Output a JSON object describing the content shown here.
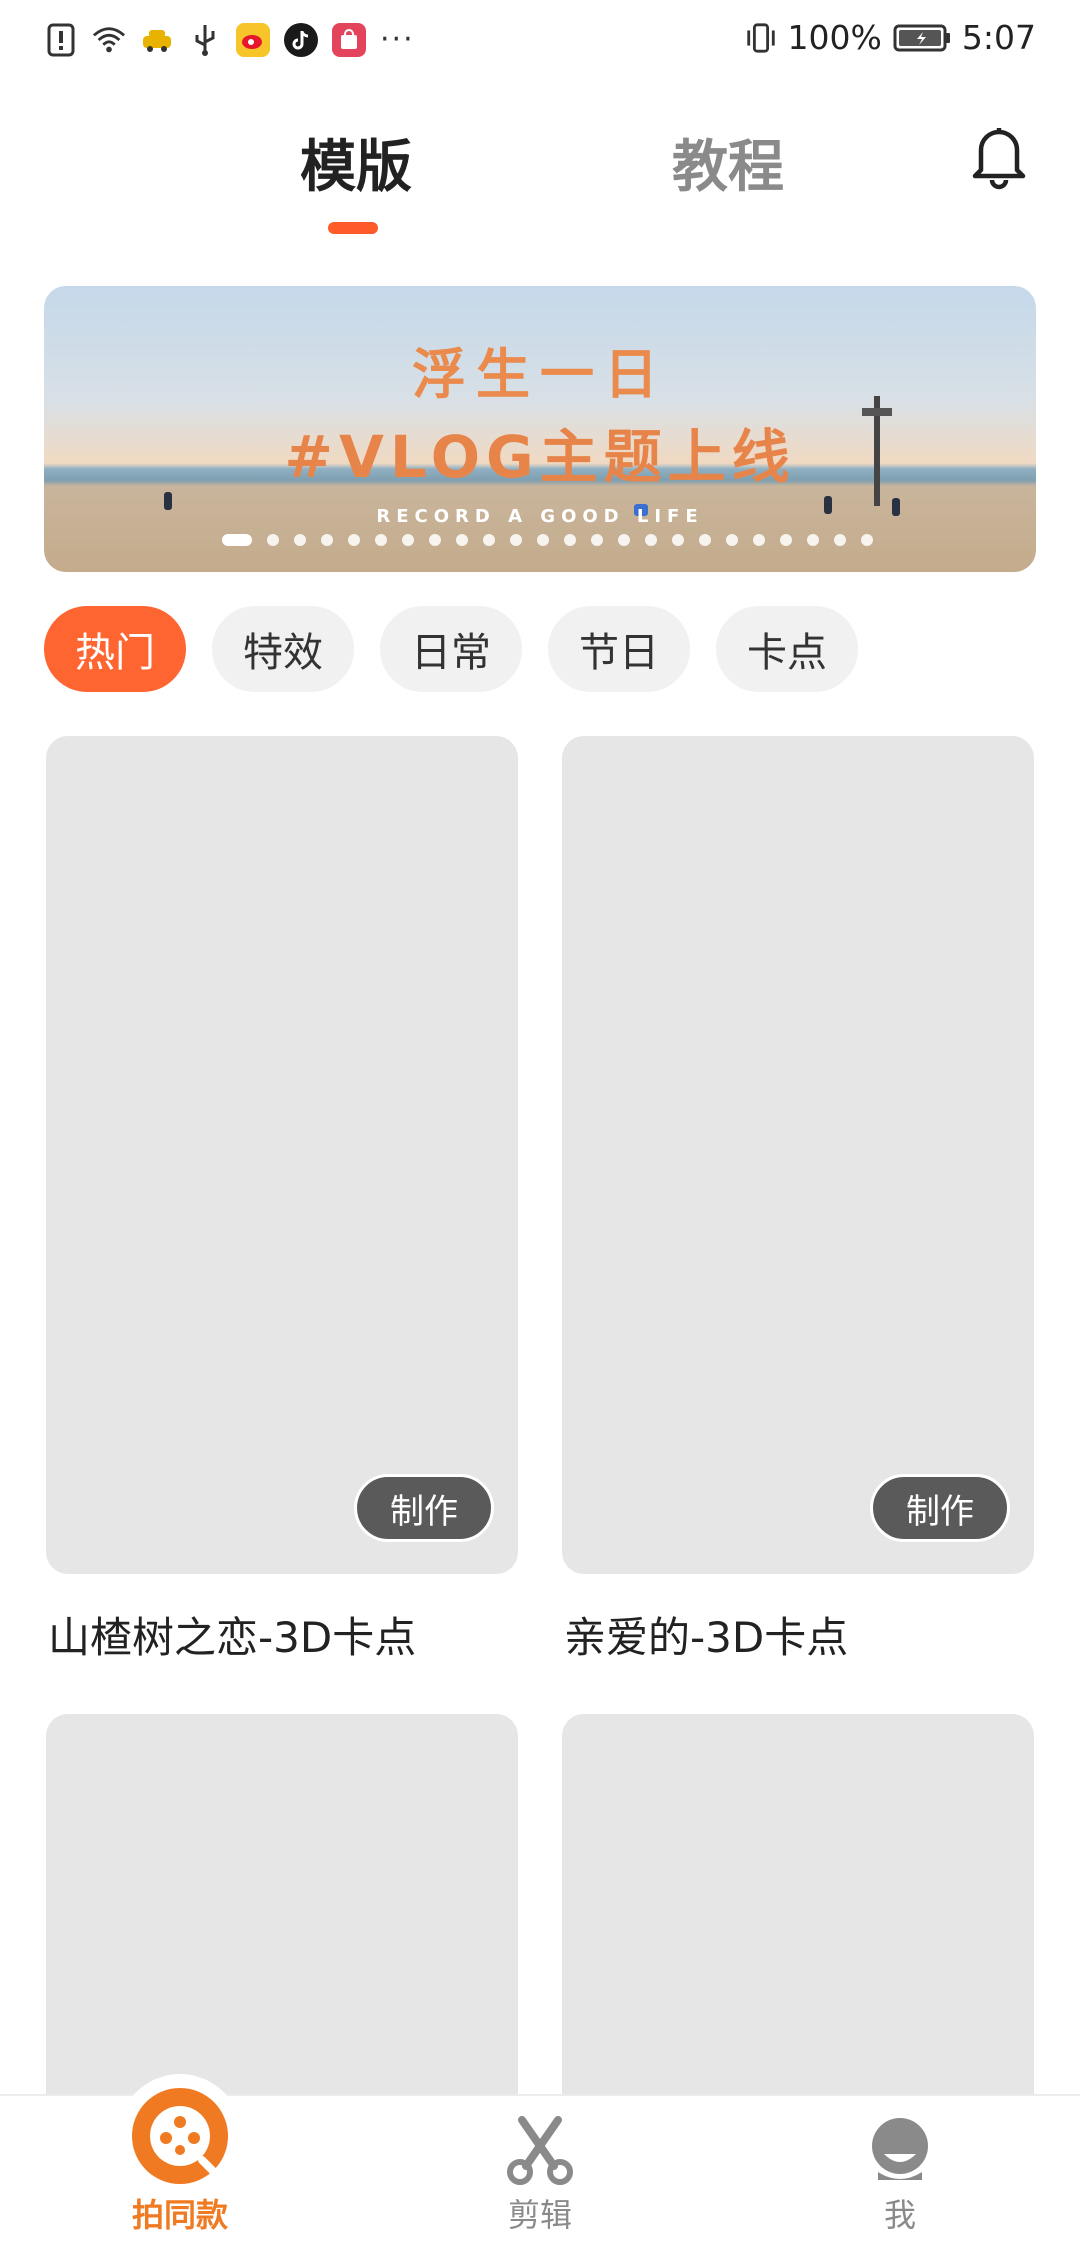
{
  "status_bar": {
    "overflow": "···",
    "battery": "100%",
    "time": "5:07"
  },
  "header": {
    "tabs": [
      {
        "label": "模版",
        "active": true
      },
      {
        "label": "教程",
        "active": false
      }
    ],
    "notification_icon": "bell-icon"
  },
  "banner": {
    "title": "浮生一日",
    "subtitle": "#VLOG主题上线",
    "tagline": "RECORD A GOOD LIFE",
    "page_count": 24,
    "current_page": 1
  },
  "categories": [
    {
      "label": "热门",
      "active": true
    },
    {
      "label": "特效",
      "active": false
    },
    {
      "label": "日常",
      "active": false
    },
    {
      "label": "节日",
      "active": false
    },
    {
      "label": "卡点",
      "active": false
    }
  ],
  "templates": [
    {
      "title": "山楂树之恋-3D卡点",
      "action": "制作"
    },
    {
      "title": "亲爱的-3D卡点",
      "action": "制作"
    },
    {
      "title": "",
      "action": ""
    },
    {
      "title": "",
      "action": ""
    }
  ],
  "bottom_nav": [
    {
      "label": "拍同款",
      "icon": "film-reel-icon",
      "active": true
    },
    {
      "label": "剪辑",
      "icon": "scissors-icon",
      "active": false
    },
    {
      "label": "我",
      "icon": "profile-icon",
      "active": false
    }
  ],
  "colors": {
    "accent": "#ff6530",
    "indicator": "#ff5a2a",
    "nav_active": "#f07a22",
    "nav_inactive": "#8a8a8a",
    "placeholder": "#e6e6e6"
  }
}
